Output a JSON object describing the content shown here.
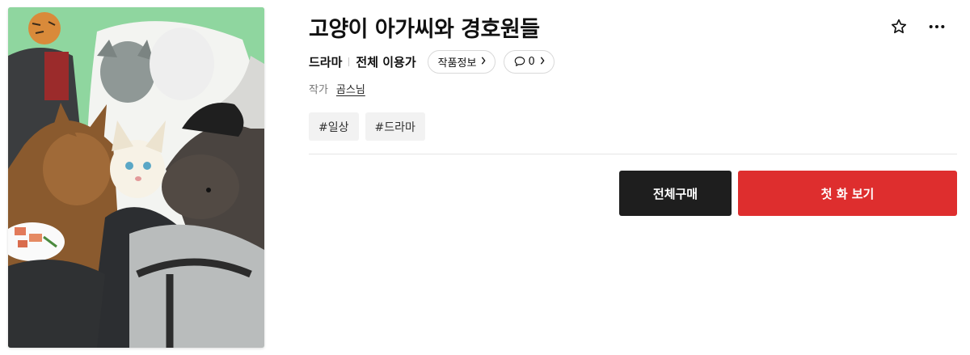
{
  "work": {
    "title": "고양이 아가씨와 경호원들",
    "genre": "드라마",
    "age_rating": "전체 이용가",
    "info_label": "작품정보",
    "comment_count": "0",
    "author_label": "작가",
    "author_name": "곰스님",
    "tags": [
      "#일상",
      "#드라마"
    ]
  },
  "actions": {
    "buy_all": "전체구매",
    "read_first": "첫 화 보기"
  },
  "icons": {
    "favorite": "star-outline-icon",
    "more": "more-dots-icon",
    "comment": "speech-bubble-icon",
    "chevron": "chevron-right-icon"
  },
  "colors": {
    "primary_red": "#de2e2e",
    "dark_button": "#1e1e1e",
    "cover_background": "#88d39a"
  }
}
